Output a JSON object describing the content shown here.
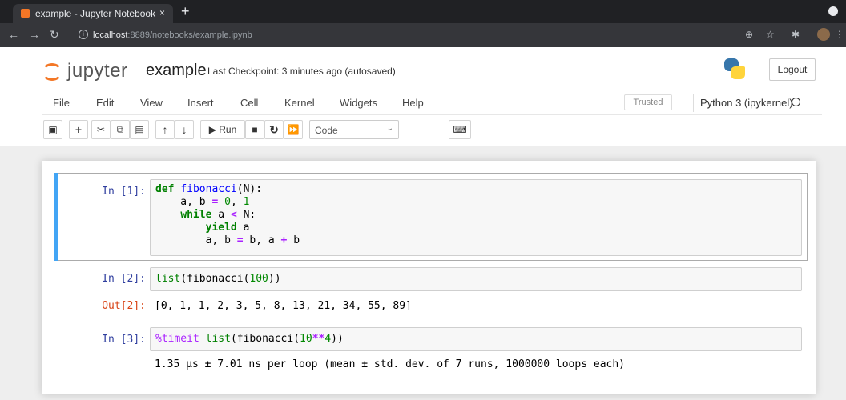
{
  "browser": {
    "tab_title": "example - Jupyter Notebook",
    "tab_close": "×",
    "new_tab": "+",
    "url_host": "localhost",
    "url_rest": ":8889/notebooks/example.ipynb",
    "icons": [
      "back-icon",
      "forward-icon",
      "reload-icon",
      "info-icon",
      "zoom-icon",
      "star-icon",
      "extensions-icon",
      "menu-icon"
    ]
  },
  "header": {
    "logo_text": "jupyter",
    "notebook_name": "example",
    "checkpoint": "Last Checkpoint: 3 minutes ago  (autosaved)",
    "logout": "Logout"
  },
  "menu": {
    "items": [
      "File",
      "Edit",
      "View",
      "Insert",
      "Cell",
      "Kernel",
      "Widgets",
      "Help"
    ],
    "trusted": "Trusted",
    "kernel": "Python 3 (ipykernel)"
  },
  "toolbar": {
    "run_label": "▶ Run",
    "cell_type": "Code"
  },
  "cells": [
    {
      "prompt": "In [1]:",
      "code": [
        "def fibonacci(N):",
        "    a, b = 0, 1",
        "    while a < N:",
        "        yield a",
        "        a, b = b, a + b"
      ]
    },
    {
      "prompt": "In [2]:",
      "code": [
        "list(fibonacci(100))"
      ],
      "out_prompt": "Out[2]:",
      "output": "[0, 1, 1, 2, 3, 5, 8, 13, 21, 34, 55, 89]"
    },
    {
      "prompt": "In [3]:",
      "code": [
        "%timeit list(fibonacci(10**4))"
      ],
      "output": "1.35 µs ± 7.01 ns per loop (mean ± std. dev. of 7 runs, 1000000 loops each)"
    }
  ],
  "colors": {
    "jupyter_orange": "#f37726",
    "selected_bar": "#42a5f5",
    "in_prompt": "#303f9f",
    "out_prompt": "#d84315"
  }
}
